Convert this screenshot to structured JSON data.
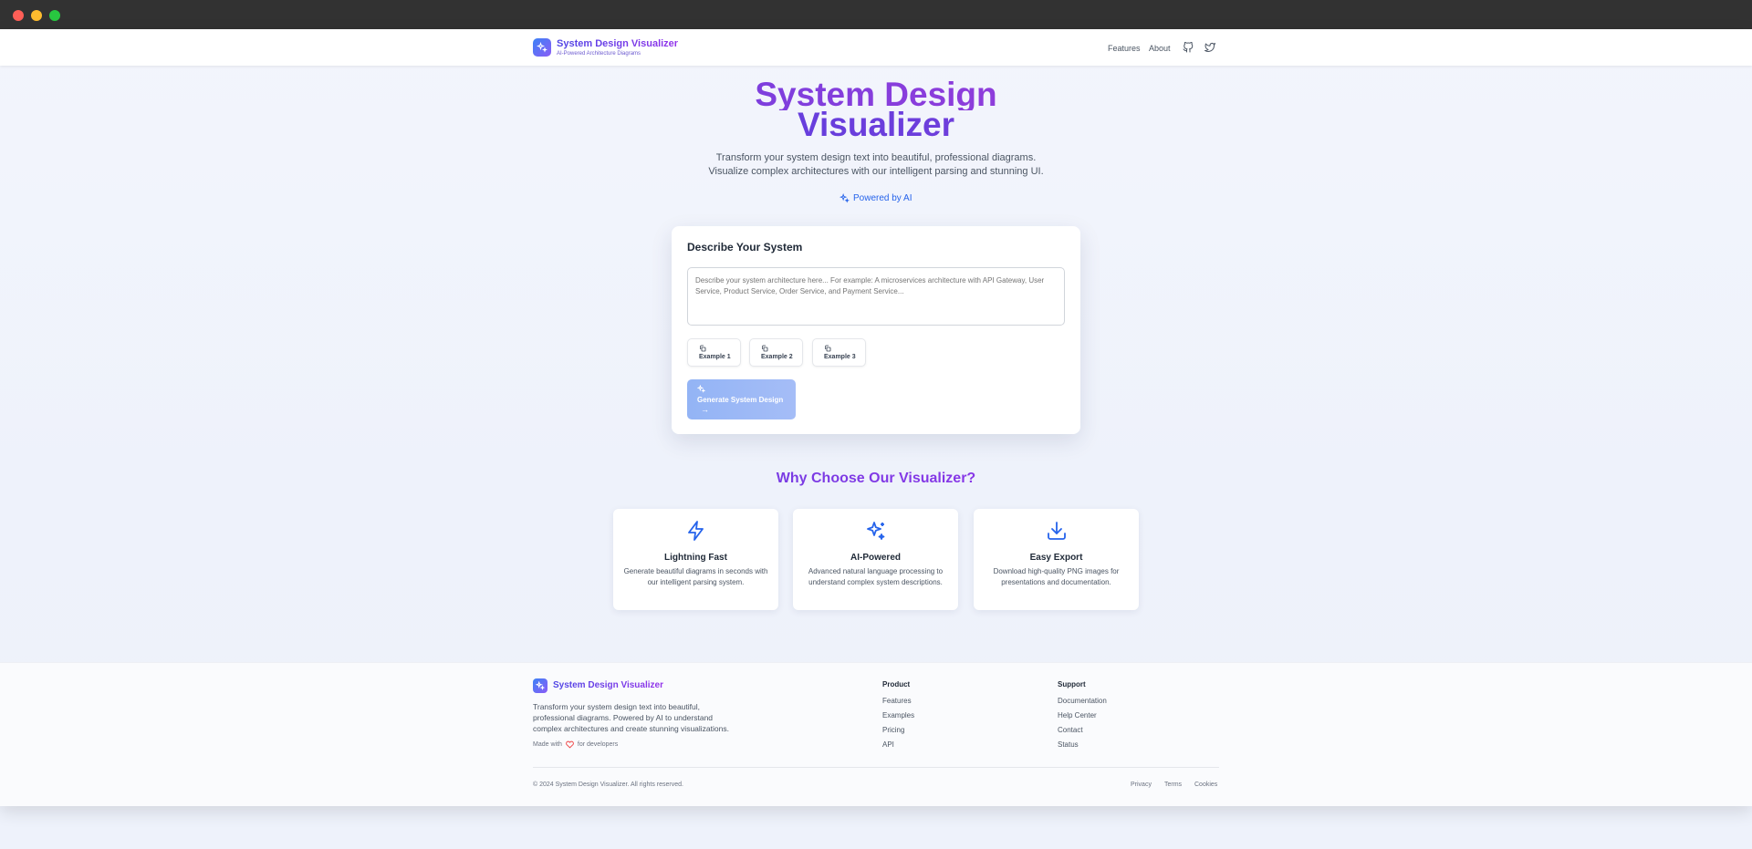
{
  "app": {
    "brand_title": "System Design Visualizer",
    "brand_subtitle": "AI-Powered Architecture Diagrams"
  },
  "nav": {
    "features": "Features",
    "about": "About",
    "icons": [
      "github-icon",
      "twitter-icon"
    ]
  },
  "hero": {
    "title_line1": "System Design",
    "title_line2": "Visualizer",
    "desc_line1": "Transform your system design text into beautiful, professional diagrams.",
    "desc_line2": "Visualize complex architectures with our intelligent parsing and stunning UI.",
    "powered": "Powered by AI"
  },
  "input_card": {
    "title": "Describe Your System",
    "placeholder": "Describe your system architecture here... For example: A microservices architecture with API Gateway, User Service, Product Service, Order Service, and Payment Service...",
    "examples": [
      "Example 1",
      "Example 2",
      "Example 3"
    ],
    "generate_label": "Generate System Design",
    "generate_arrow": "→"
  },
  "why": {
    "title": "Why Choose Our Visualizer?",
    "features": [
      {
        "title": "Lightning Fast",
        "desc": "Generate beautiful diagrams in seconds with our intelligent parsing system.",
        "icon": "lightning-icon"
      },
      {
        "title": "AI-Powered",
        "desc": "Advanced natural language processing to understand complex system descriptions.",
        "icon": "sparkles-icon"
      },
      {
        "title": "Easy Export",
        "desc": "Download high-quality PNG images for presentations and documentation.",
        "icon": "download-icon"
      }
    ]
  },
  "footer": {
    "brand": "System Design Visualizer",
    "desc": "Transform your system design text into beautiful, professional diagrams. Powered by AI to understand complex architectures and create stunning visualizations.",
    "made_prefix": "Made with",
    "made_suffix": "for developers",
    "product_heading": "Product",
    "product_links": [
      "Features",
      "Examples",
      "Pricing",
      "API"
    ],
    "support_heading": "Support",
    "support_links": [
      "Documentation",
      "Help Center",
      "Contact",
      "Status"
    ],
    "copyright": "© 2024 System Design Visualizer. All rights reserved.",
    "legal": [
      "Privacy",
      "Terms",
      "Cookies"
    ]
  },
  "colors": {
    "accent_blue": "#2563eb",
    "accent_purple": "#9333ea",
    "heart": "#ef4444"
  }
}
